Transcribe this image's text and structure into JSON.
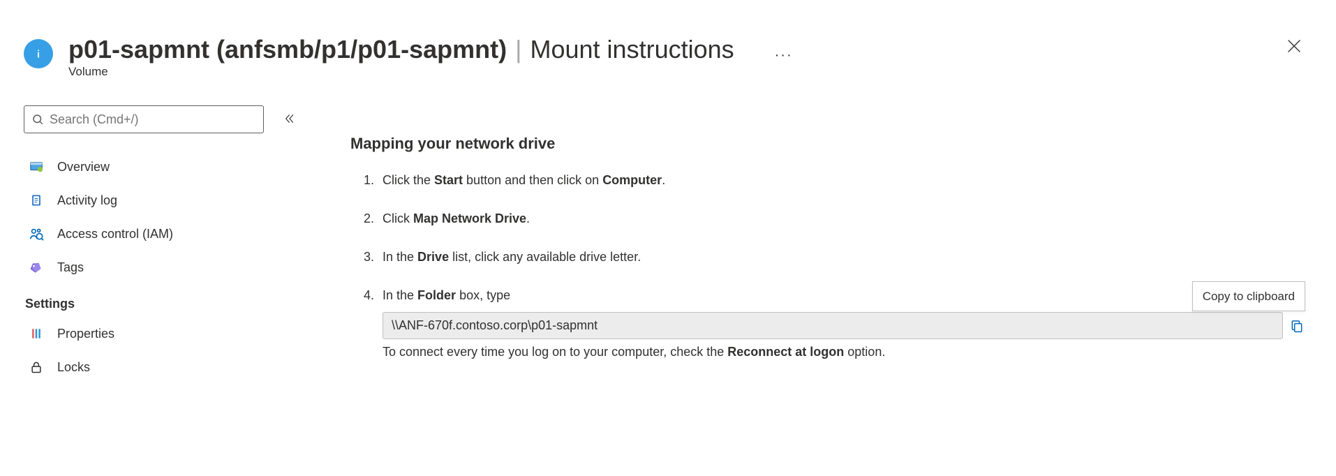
{
  "header": {
    "title_bold": "p01-sapmnt (anfsmb/p1/p01-sapmnt)",
    "title_suffix": "Mount instructions",
    "subtitle": "Volume"
  },
  "sidebar": {
    "search_placeholder": "Search (Cmd+/)",
    "items": [
      {
        "label": "Overview"
      },
      {
        "label": "Activity log"
      },
      {
        "label": "Access control (IAM)"
      },
      {
        "label": "Tags"
      }
    ],
    "settings_heading": "Settings",
    "settings_items": [
      {
        "label": "Properties"
      },
      {
        "label": "Locks"
      }
    ]
  },
  "content": {
    "heading": "Mapping your network drive",
    "step1_pre": "Click the ",
    "step1_b1": "Start",
    "step1_mid": " button and then click on ",
    "step1_b2": "Computer",
    "step1_post": ".",
    "step2_pre": "Click ",
    "step2_b1": "Map Network Drive",
    "step2_post": ".",
    "step3_pre": "In the ",
    "step3_b1": "Drive",
    "step3_post": " list, click any available drive letter.",
    "step4_pre": "In the ",
    "step4_b1": "Folder",
    "step4_post": " box, type",
    "path": "\\\\ANF-670f.contoso.corp\\p01-sapmnt",
    "followup_pre": "To connect every time you log on to your computer, check the ",
    "followup_b1": "Reconnect at logon",
    "followup_post": " option.",
    "tooltip": "Copy to clipboard"
  }
}
